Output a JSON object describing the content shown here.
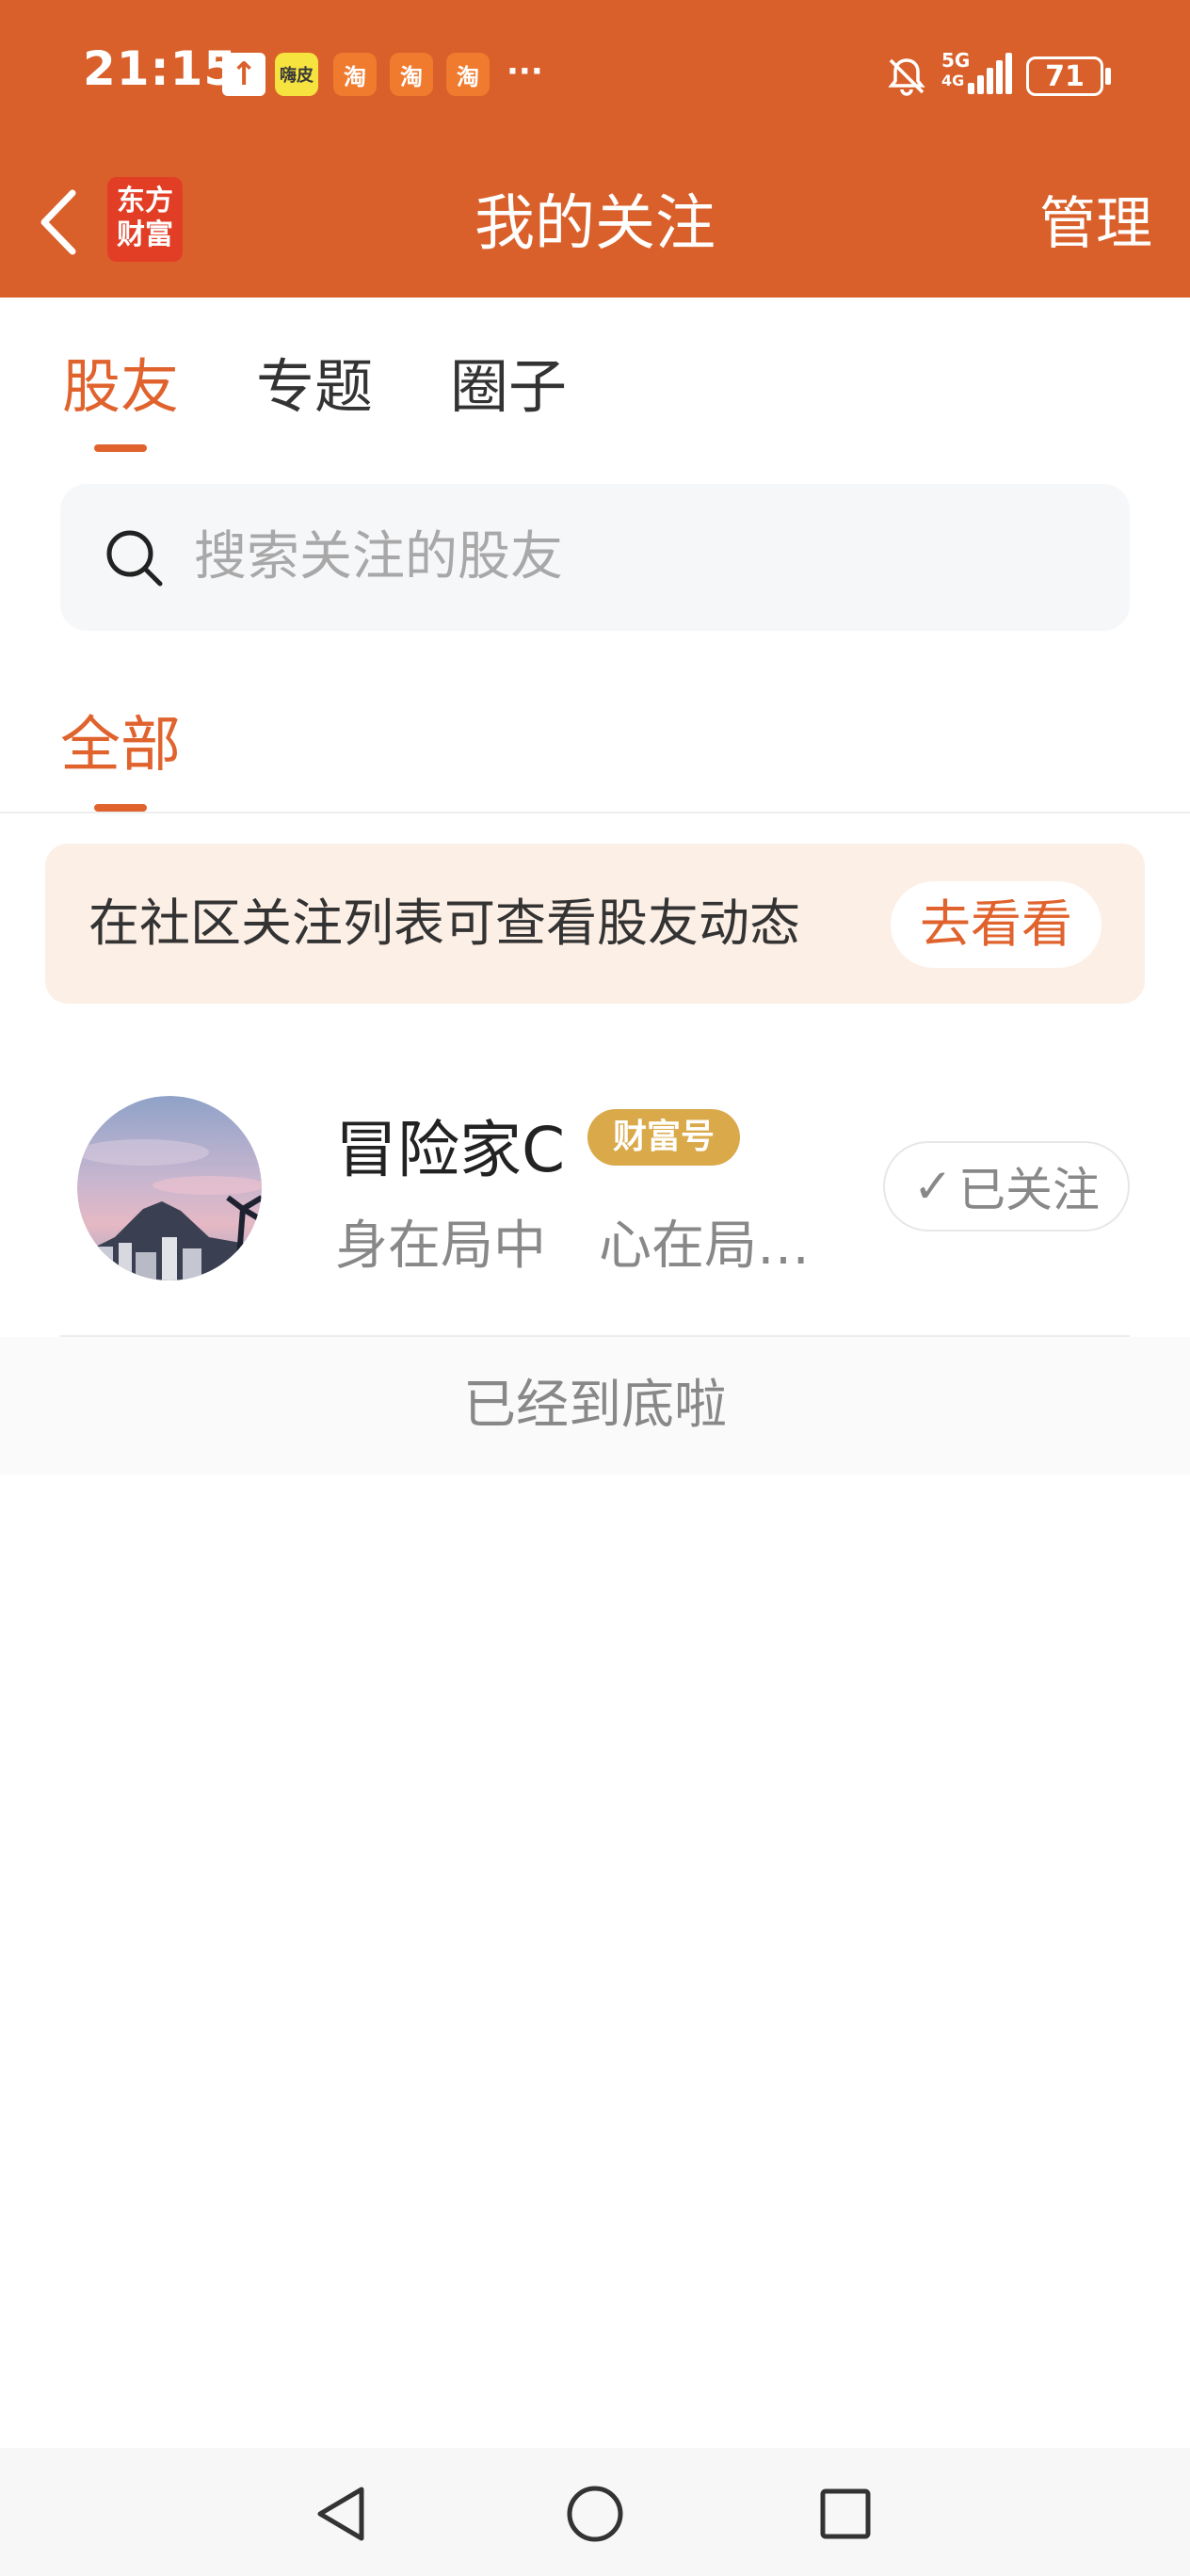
{
  "status_bar": {
    "time": "21:15",
    "icons": [
      "upload-icon",
      "app-icon",
      "taobao-icon",
      "taobao-icon",
      "taobao-icon",
      "more-icon",
      "mute-bell-icon",
      "signal-5g-icon",
      "battery-icon"
    ],
    "app_icon_text": "嗨皮",
    "taobao_text": "淘",
    "more": "···",
    "network": "5G",
    "network_sub": "4G",
    "battery": "71"
  },
  "app_bar": {
    "title": "我的关注",
    "logo_line1": "东方",
    "logo_line2": "财富",
    "manage_label": "管理"
  },
  "tabs": [
    {
      "label": "股友",
      "active": true
    },
    {
      "label": "专题",
      "active": false
    },
    {
      "label": "圈子",
      "active": false
    }
  ],
  "search": {
    "placeholder": "搜索关注的股友"
  },
  "filter": {
    "label": "全部"
  },
  "banner": {
    "text": "在社区关注列表可查看股友动态",
    "button": "去看看"
  },
  "following": [
    {
      "name": "冒险家C",
      "badge": "财富号",
      "bio": "身在局中　心在局…",
      "follow_label": "已关注",
      "follow_check": "✓"
    }
  ],
  "end_text": "已经到底啦",
  "colors": {
    "brand": "#D9602A",
    "accent": "#E0632E",
    "badge": "#D9A94A",
    "banner_bg": "#FCEFE6"
  }
}
